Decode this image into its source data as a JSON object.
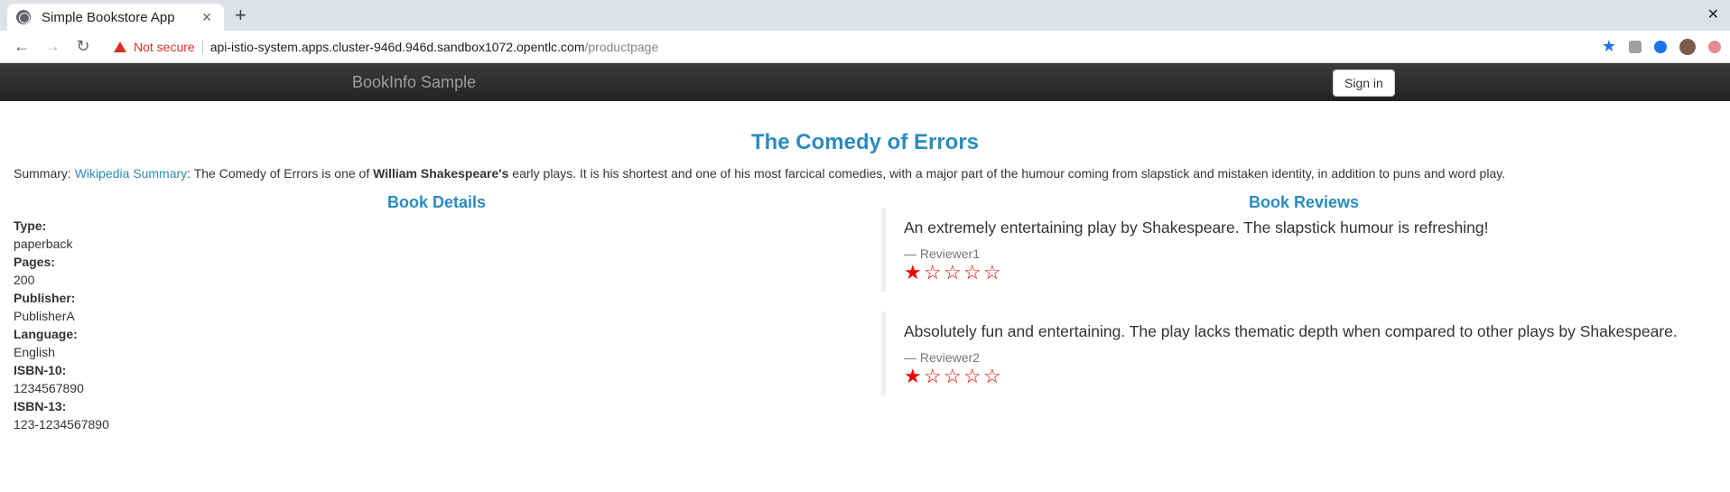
{
  "browser": {
    "tab_title": "Simple Bookstore App",
    "tab_close": "×",
    "new_tab": "+",
    "window_close": "✕",
    "not_secure": "Not secure",
    "url_host": "api-istio-system.apps.cluster-946d.946d.sandbox1072.opentlc.com",
    "url_path": "/productpage"
  },
  "navbar": {
    "brand": "BookInfo Sample",
    "signin": "Sign in"
  },
  "book": {
    "title": "The Comedy of Errors",
    "summary_prefix": "Summary: ",
    "summary_link": "Wikipedia Summary",
    "summary_mid": ": The Comedy of Errors is one of ",
    "summary_bold": "William Shakespeare's",
    "summary_suffix": " early plays. It is his shortest and one of his most farcical comedies, with a major part of the humour coming from slapstick and mistaken identity, in addition to puns and word play."
  },
  "details": {
    "heading": "Book Details",
    "type_label": "Type:",
    "type_value": "paperback",
    "pages_label": "Pages:",
    "pages_value": "200",
    "publisher_label": "Publisher:",
    "publisher_value": "PublisherA",
    "language_label": "Language:",
    "language_value": "English",
    "isbn10_label": "ISBN-10:",
    "isbn10_value": "1234567890",
    "isbn13_label": "ISBN-13:",
    "isbn13_value": "123-1234567890"
  },
  "reviews": {
    "heading": "Book Reviews",
    "items": [
      {
        "text": "An extremely entertaining play by Shakespeare. The slapstick humour is refreshing!",
        "reviewer": "— Reviewer1",
        "rating": 1,
        "max": 5
      },
      {
        "text": "Absolutely fun and entertaining. The play lacks thematic depth when compared to other plays by Shakespeare.",
        "reviewer": "— Reviewer2",
        "rating": 1,
        "max": 5
      }
    ]
  },
  "colors": {
    "link": "#2a8bbf",
    "star": "#ee0000",
    "navbar": "#222222"
  }
}
